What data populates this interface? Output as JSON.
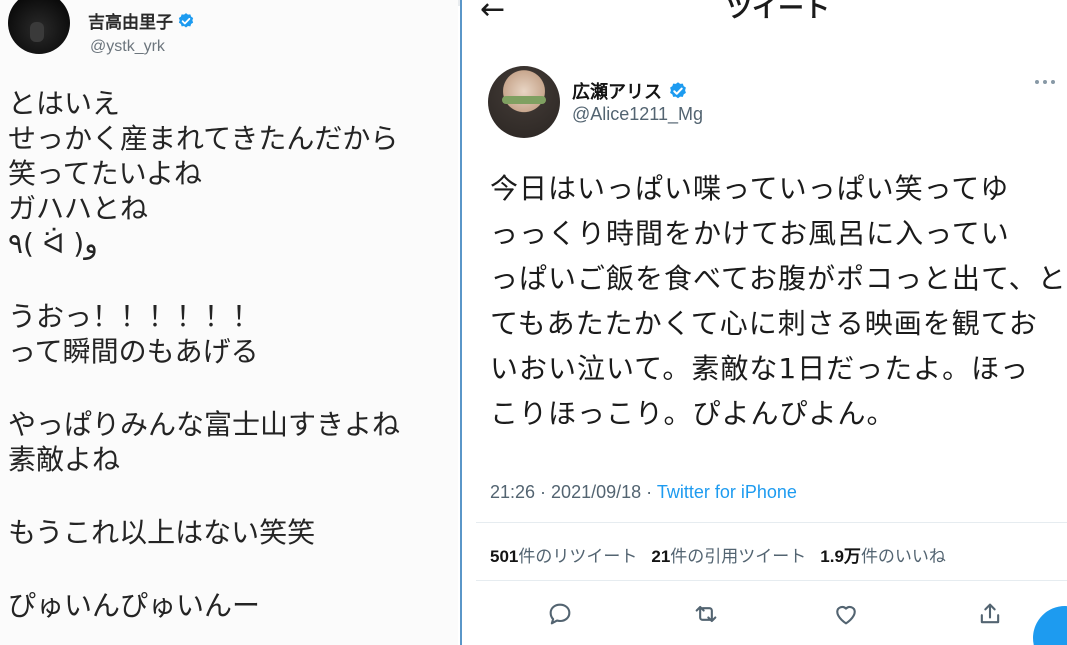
{
  "left_tweet": {
    "display_name": "吉高由里子",
    "handle": "@ystk_yrk",
    "lines": [
      "とはいえ",
      "せっかく産まれてきたんだから",
      "笑ってたいよね",
      "ガハハとね",
      "٩( ᐛ )و",
      "",
      "うおっ！！！！！！",
      "って瞬間のもあげる",
      "",
      "やっぱりみんな富士山すきよね",
      "素敵よね",
      "",
      "もうこれ以上はない笑笑",
      "",
      "ぴゅいんぴゅいんー"
    ]
  },
  "right_tweet": {
    "header_title": "ツイート",
    "display_name": "広瀬アリス",
    "handle": "@Alice1211_Mg",
    "lines": [
      "今日はいっぱい喋っていっぱい笑ってゆ",
      "っっくり時間をかけてお風呂に入ってい",
      "っぱいご飯を食べてお腹がポコっと出て、と",
      "てもあたたかくて心に刺さる映画を観てお",
      "いおい泣いて。素敵な1日だったよ。ほっ",
      "こりほっこり。ぴよんぴよん。"
    ],
    "time": "21:26",
    "date": "2021/09/18",
    "separator": " · ",
    "source": "Twitter for iPhone",
    "stats": {
      "retweets_count": "501",
      "retweets_label": "件のリツイート",
      "quotes_count": "21",
      "quotes_label": "件の引用ツイート",
      "likes_count": "1.9万",
      "likes_label": "件のいいね"
    }
  },
  "icons": {
    "verified": "verified-badge-icon",
    "back": "arrow-left-icon",
    "more": "more-dots-icon",
    "reply": "reply-icon",
    "retweet": "retweet-icon",
    "like": "heart-icon",
    "share": "share-icon"
  },
  "colors": {
    "verified_blue": "#1d9bf0",
    "secondary_text": "#536471",
    "link": "#1d9bf0",
    "panel_border": "#5a96c8"
  }
}
